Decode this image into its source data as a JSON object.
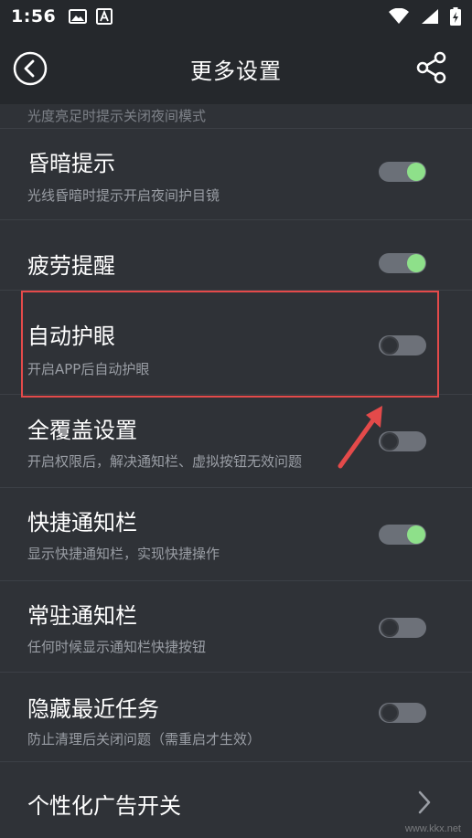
{
  "status_bar": {
    "time": "1:56"
  },
  "app_bar": {
    "title": "更多设置"
  },
  "partial_row": {
    "subtitle": "光度亮足时提示关闭夜间模式"
  },
  "settings": [
    {
      "title": "昏暗提示",
      "subtitle": "光线昏暗时提示开启夜间护目镜",
      "toggle": "on"
    },
    {
      "title": "疲劳提醒",
      "subtitle": "",
      "toggle": "on"
    },
    {
      "title": "自动护眼",
      "subtitle": "开启APP后自动护眼",
      "toggle": "off"
    },
    {
      "title": "全覆盖设置",
      "subtitle": "开启权限后，解决通知栏、虚拟按钮无效问题",
      "toggle": "off"
    },
    {
      "title": "快捷通知栏",
      "subtitle": "显示快捷通知栏，实现快捷操作",
      "toggle": "on"
    },
    {
      "title": "常驻通知栏",
      "subtitle": "任何时候显示通知栏快捷按钮",
      "toggle": "off"
    },
    {
      "title": "隐藏最近任务",
      "subtitle": "防止清理后关闭问题（需重启才生效）",
      "toggle": "off"
    },
    {
      "title": "个性化广告开关",
      "subtitle": "",
      "toggle": "none"
    }
  ],
  "watermark": "www.kkx.net",
  "colors": {
    "toggle_on_knob": "#8ee08a",
    "annotation": "#e44a4a",
    "background": "#2f3237",
    "bar": "#25282c"
  }
}
